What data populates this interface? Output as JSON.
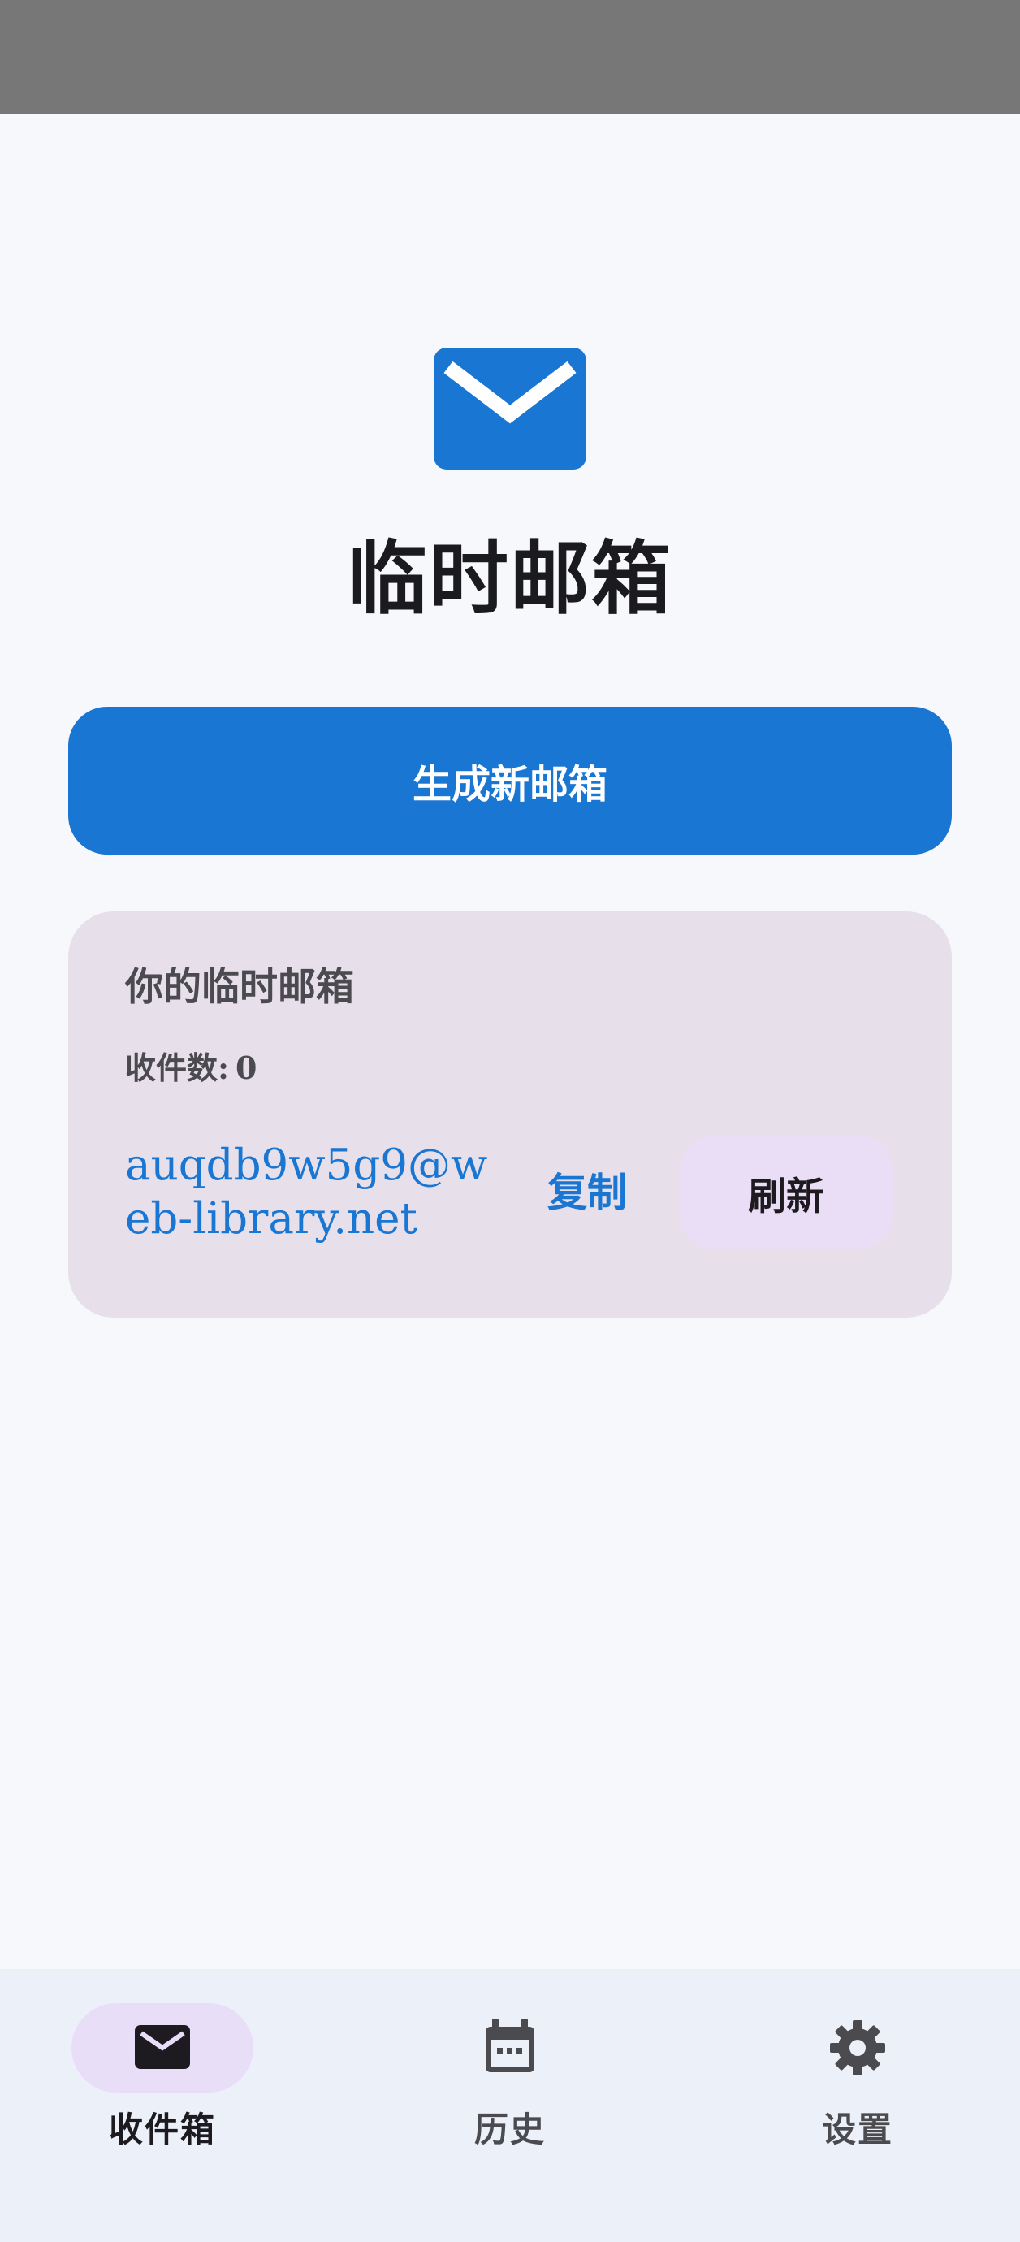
{
  "app": {
    "title": "临时邮箱"
  },
  "actions": {
    "generate_label": "生成新邮箱"
  },
  "email_card": {
    "title": "你的临时邮箱",
    "count_label": "收件数:",
    "count_value": "0",
    "address": "auqdb9w5g9@web-library.net",
    "copy_label": "复制",
    "refresh_label": "刷新"
  },
  "bottom_nav": {
    "items": [
      {
        "label": "收件箱",
        "icon": "mail-icon",
        "active": true
      },
      {
        "label": "历史",
        "icon": "calendar-icon",
        "active": false
      },
      {
        "label": "设置",
        "icon": "gear-icon",
        "active": false
      }
    ]
  },
  "colors": {
    "primary": "#1976D2",
    "card_bg": "#E7DFEA",
    "nav_bg": "#ECF1F9",
    "nav_active": "#E8DEF8",
    "status_bar": "#777777"
  }
}
